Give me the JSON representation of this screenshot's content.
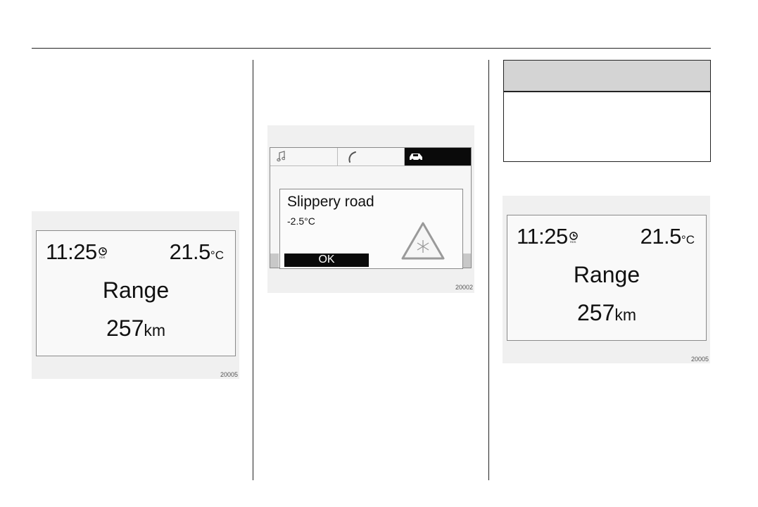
{
  "left_display": {
    "time": "11:25",
    "rds_label": "RDS",
    "temperature": "21.5",
    "temperature_unit": "°C",
    "label": "Range",
    "range_value": "257",
    "range_unit": "km",
    "figure_code": "20005"
  },
  "middle_display": {
    "tabs": [
      {
        "icon": "music-note-icon",
        "active": false
      },
      {
        "icon": "phone-icon",
        "active": false
      },
      {
        "icon": "car-icon",
        "active": true
      }
    ],
    "message_title": "Slippery road",
    "message_temperature": "-2.5°C",
    "ok_label": "OK",
    "warning_icon": "ice-warning-triangle-icon",
    "figure_code": "20002"
  },
  "right_display": {
    "time": "11:25",
    "rds_label": "RDS",
    "temperature": "21.5",
    "temperature_unit": "°C",
    "label": "Range",
    "range_value": "257",
    "range_unit": "km",
    "figure_code": "20005"
  }
}
